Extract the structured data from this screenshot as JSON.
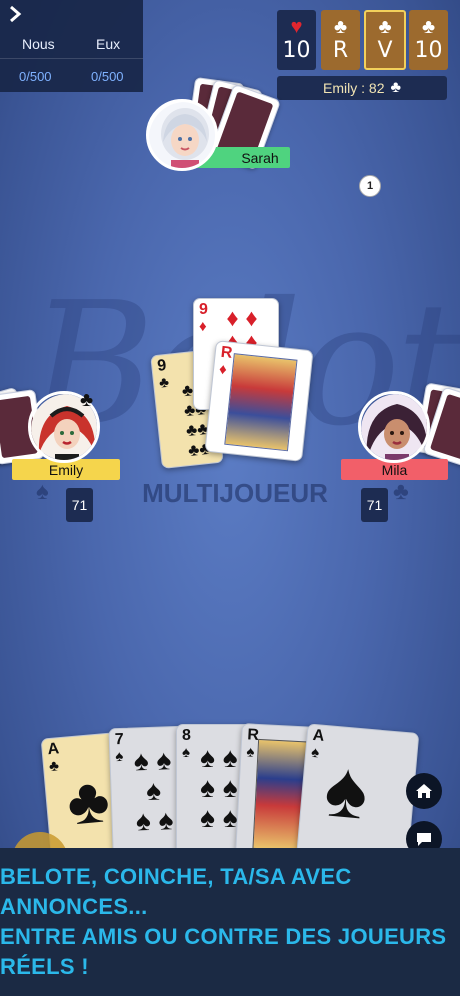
{
  "scoreboard": {
    "toggle_icon": "chevron-right-icon",
    "team_us_label": "Nous",
    "team_them_label": "Eux",
    "team_us_score": "0/500",
    "team_them_score": "0/500"
  },
  "contract": {
    "boxes": [
      {
        "suit": "♥",
        "value": "10",
        "suit_color": "#e0262f",
        "style": "dark"
      },
      {
        "suit": "♣",
        "value": "R",
        "suit_color": "#ffffff",
        "style": "brown"
      },
      {
        "suit": "♣",
        "value": "V",
        "suit_color": "#ffffff",
        "style": "brown-selected"
      },
      {
        "suit": "♣",
        "value": "10",
        "suit_color": "#ffffff",
        "style": "brown"
      }
    ],
    "announcement": "Emily : 82",
    "announcement_suit": "♣"
  },
  "players": {
    "top": {
      "name": "Sarah",
      "tag_color": "#4fd37f"
    },
    "left": {
      "name": "Emily",
      "tag_color": "#f5d54c",
      "score": "71",
      "dealer_suit": "♣"
    },
    "right": {
      "name": "Mila",
      "tag_color": "#f25f69",
      "score": "71"
    }
  },
  "trick_count": "1",
  "logo": {
    "script": "Belote",
    "subtitle": "MULTIJOUEUR"
  },
  "table_cards": [
    {
      "rank": "9",
      "suit": "♣",
      "color": "black"
    },
    {
      "rank": "9",
      "suit": "♦",
      "color": "red"
    },
    {
      "rank": "R",
      "suit": "♦",
      "color": "red"
    }
  ],
  "hand_cards": [
    {
      "rank": "A",
      "suit": "♣",
      "color": "black",
      "playable": true
    },
    {
      "rank": "7",
      "suit": "♠",
      "color": "black",
      "playable": false
    },
    {
      "rank": "8",
      "suit": "♠",
      "color": "black",
      "playable": false
    },
    {
      "rank": "R",
      "suit": "♠",
      "color": "black",
      "playable": false
    },
    {
      "rank": "A",
      "suit": "♠",
      "color": "black",
      "playable": false
    }
  ],
  "side_buttons": {
    "home_icon": "home-icon",
    "chat_icon": "chat-icon"
  },
  "banner": {
    "line1": "BELOTE, COINCHE, TA/SA AVEC ANNONCES...",
    "line2": "ENTRE AMIS OU CONTRE DES JOUEURS RÉELS !"
  }
}
